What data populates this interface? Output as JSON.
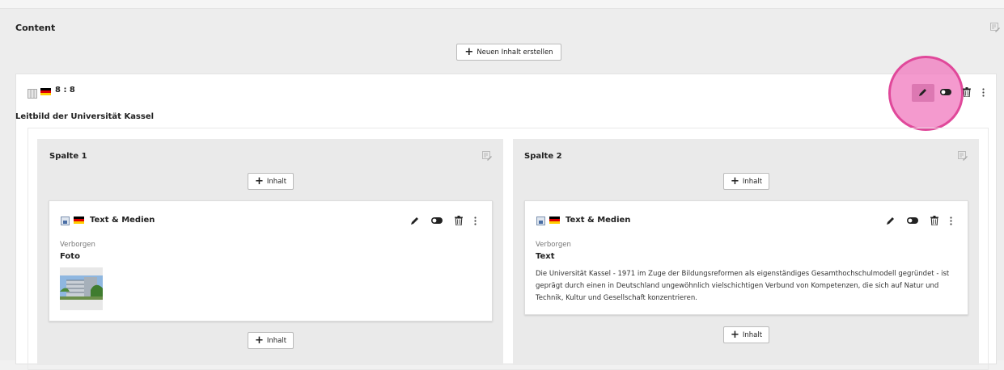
{
  "page": {
    "section_title": "Content",
    "new_content_button": "Neuen Inhalt erstellen"
  },
  "container": {
    "ratio_label": "8 : 8",
    "record_title": "Leitbild der Universität Kassel",
    "flag": "de",
    "icons": [
      "edit-pencil-icon",
      "toggle-visibility-icon",
      "trash-icon",
      "more-vertical-icon"
    ],
    "columns": [
      {
        "title": "Spalte 1",
        "add_top_label": "Inhalt",
        "add_bottom_label": "Inhalt",
        "element": {
          "title": "Text & Medien",
          "hidden_label": "Verborgen",
          "header": "Foto",
          "has_image": true
        }
      },
      {
        "title": "Spalte 2",
        "add_top_label": "Inhalt",
        "add_bottom_label": "Inhalt",
        "element": {
          "title": "Text & Medien",
          "hidden_label": "Verborgen",
          "header": "Text",
          "bodytext": "Die Universität Kassel - 1971 im Zuge der Bildungsreformen als eigenständiges Gesamthochschulmodell gegründet - ist geprägt durch einen in Deutschland ungewöhnlich vielschichtigen Verbund von Kompetenzen, die sich auf Natur und Technik, Kultur und Gesellschaft konzentrieren."
        }
      }
    ]
  },
  "colors": {
    "highlight": "#e0489a",
    "flag_black": "#000000",
    "flag_red": "#dd0000",
    "flag_gold": "#ffce00"
  }
}
